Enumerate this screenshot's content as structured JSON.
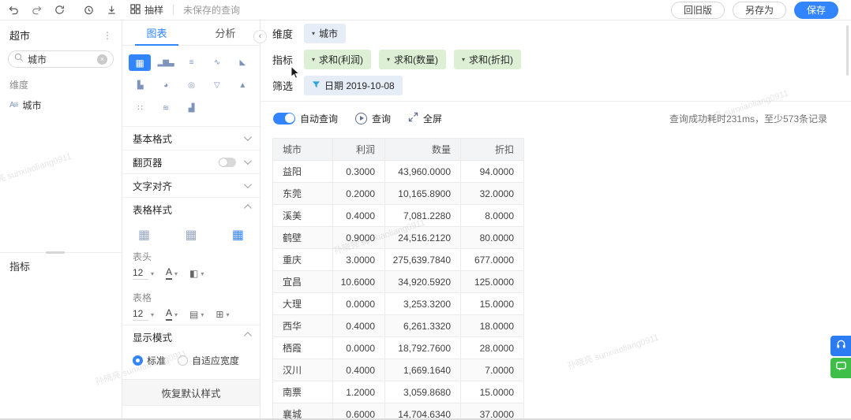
{
  "colors": {
    "accent": "#3385ff",
    "green_tag_bg": "#ddf0d6",
    "blue_tag_bg": "#e7edf6",
    "save_button_bg": "#3385ff"
  },
  "icons": {
    "caret": "▾",
    "menu_dots": "⋮",
    "collapse": "‹",
    "clear": "×",
    "dimension_field": "A≡",
    "bucket": "◧",
    "border_style": "▤",
    "grid_borders": "⊞",
    "font_letter": "A"
  },
  "watermark": {
    "text": "孙晓亮 sunxiaoliang0911"
  },
  "topbar": {
    "sample_label": "抽样",
    "unsaved_query": "未保存的查询",
    "old_version_button": "回旧版",
    "save_as_button": "另存为",
    "save_button": "保存"
  },
  "sidebar": {
    "title": "超市",
    "search_value": "城市",
    "dimension_section_label": "维度",
    "dimension_field": "城市",
    "metric_section_label": "指标"
  },
  "panel": {
    "tabs": [
      "图表",
      "分析"
    ],
    "chart_types": [
      {
        "name": "table",
        "glyph": "▦",
        "selected": true
      },
      {
        "name": "bar",
        "glyph": "▂▆▃"
      },
      {
        "name": "bar-horizontal",
        "glyph": "≡"
      },
      {
        "name": "line",
        "glyph": "∿"
      },
      {
        "name": "area",
        "glyph": "◣"
      },
      {
        "name": "stacked-bar",
        "glyph": "▙"
      },
      {
        "name": "pie",
        "glyph": "◕"
      },
      {
        "name": "bubble",
        "glyph": "◎"
      },
      {
        "name": "funnel",
        "glyph": "▽"
      },
      {
        "name": "pyramid",
        "glyph": "▲"
      },
      {
        "name": "scatter",
        "glyph": "∷"
      },
      {
        "name": "biaxial",
        "glyph": "≋"
      },
      {
        "name": "waterfall",
        "glyph": "▟"
      }
    ],
    "sections": {
      "basic_format_label": "基本格式",
      "pager_label": "翻页器",
      "text_align_label": "文字对齐",
      "table_style_label": "表格样式",
      "display_mode_label": "显示模式"
    },
    "table_style": {
      "options": [
        {
          "name": "plain",
          "glyph": "▦"
        },
        {
          "name": "header",
          "glyph": "▦"
        },
        {
          "name": "blue",
          "glyph": "▦",
          "selected": true
        }
      ],
      "header_group_label": "表头",
      "header_font_size": "12",
      "table_group_label": "表格",
      "table_font_size": "12"
    },
    "display_mode": {
      "standard": "标准",
      "adaptive": "自适应宽度"
    },
    "reset_button": "恢复默认样式"
  },
  "config": {
    "dimension_label": "维度",
    "dimension_tag": "城市",
    "metric_label": "指标",
    "metric_tags": [
      "求和(利润)",
      "求和(数量)",
      "求和(折扣)"
    ],
    "filter_label": "筛选",
    "filter_tag": "日期 2019-10-08"
  },
  "query_bar": {
    "auto_query_label": "自动查询",
    "query_button": "查询",
    "fullscreen_label": "全屏",
    "status_text": "查询成功耗时231ms，至少573条记录"
  },
  "chart_data": {
    "type": "table",
    "columns": [
      "城市",
      "利润",
      "数量",
      "折扣"
    ],
    "rows": [
      [
        "益阳",
        "0.3000",
        "43,960.0000",
        "94.0000"
      ],
      [
        "东莞",
        "0.2000",
        "10,165.8900",
        "32.0000"
      ],
      [
        "溪美",
        "0.4000",
        "7,081.2280",
        "8.0000"
      ],
      [
        "鹤壁",
        "0.9000",
        "24,516.2120",
        "80.0000"
      ],
      [
        "重庆",
        "3.0000",
        "275,639.7840",
        "677.0000"
      ],
      [
        "宜昌",
        "10.6000",
        "34,920.5920",
        "125.0000"
      ],
      [
        "大理",
        "0.0000",
        "3,253.3200",
        "15.0000"
      ],
      [
        "西华",
        "0.4000",
        "6,261.3320",
        "18.0000"
      ],
      [
        "栖霞",
        "0.0000",
        "18,792.7600",
        "28.0000"
      ],
      [
        "汉川",
        "0.4000",
        "1,669.1640",
        "7.0000"
      ],
      [
        "南票",
        "1.2000",
        "3,059.8680",
        "15.0000"
      ],
      [
        "襄城",
        "0.6000",
        "14,704.6340",
        "37.0000"
      ]
    ]
  }
}
